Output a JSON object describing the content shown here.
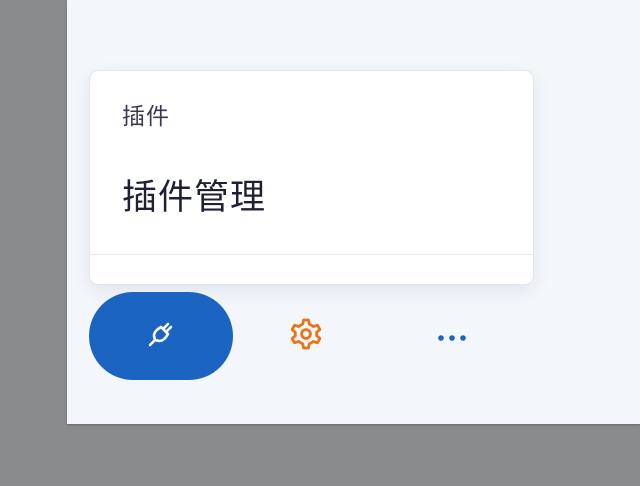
{
  "popup": {
    "header": "插件",
    "item": "插件管理"
  },
  "toolbar": {
    "plug_icon": "plug-icon",
    "gear_icon": "gear-icon",
    "more_icon": "more-dots-icon"
  },
  "colors": {
    "accent": "#1c64c2",
    "gear": "#e8751a",
    "dots": "#1c64c2"
  }
}
